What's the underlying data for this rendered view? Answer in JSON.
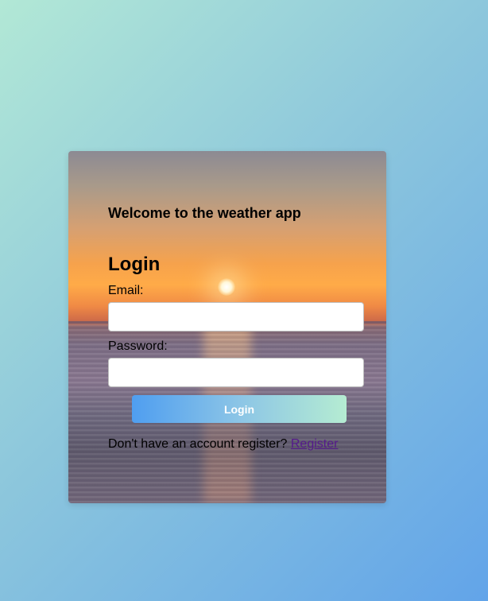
{
  "card": {
    "welcome_text": "Welcome to the weather app",
    "login_title": "Login",
    "email_label": "Email:",
    "email_value": "",
    "password_label": "Password:",
    "password_value": "",
    "login_button_label": "Login",
    "register_prompt": "Don't have an account register? ",
    "register_link_label": "Register"
  },
  "colors": {
    "background_gradient_start": "#b2e8d6",
    "background_gradient_end": "#62a4e9",
    "button_gradient_start": "#4f9ef0",
    "button_gradient_end": "#b5ecd2",
    "link_color": "#551a8b"
  }
}
